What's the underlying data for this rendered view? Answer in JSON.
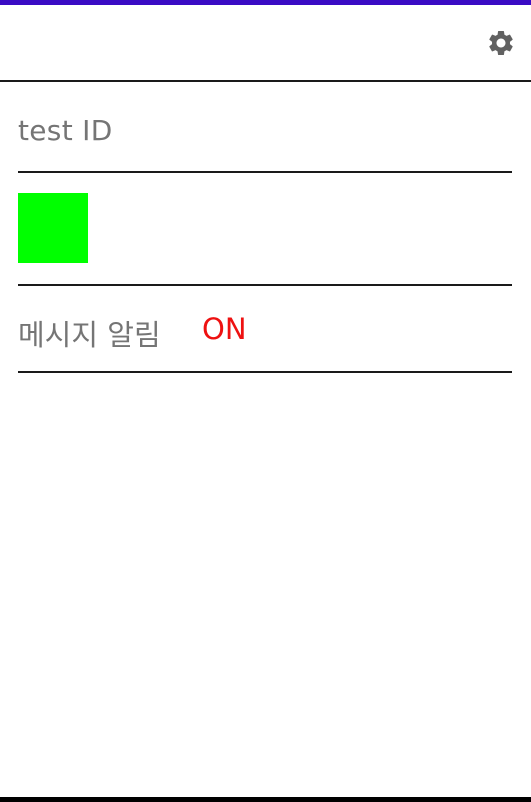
{
  "colors": {
    "status_strip": "#3a0bc4",
    "swatch": "#00ff00",
    "notify_status": "#ee1111",
    "label_gray": "#757575",
    "icon_gray": "#616161"
  },
  "app_bar": {
    "settings_icon": "gear-icon"
  },
  "profile": {
    "id_text": "test ID"
  },
  "notification": {
    "label": "메시지 알림",
    "status": "ON"
  }
}
